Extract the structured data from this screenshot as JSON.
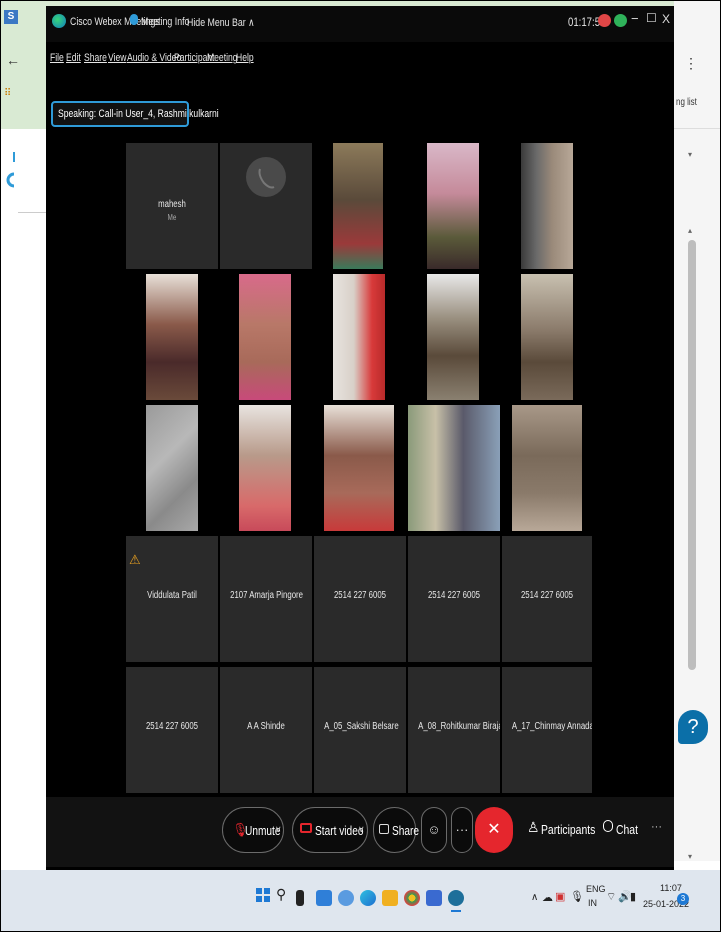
{
  "window": {
    "app_title": "Cisco Webex Meetings",
    "meeting_info": "Meeting Info",
    "hide_menu": "Hide Menu Bar ∧",
    "timer": "01:17:55",
    "minimize": "−",
    "maximize": "☐",
    "close": "X"
  },
  "menu": [
    "File",
    "Edit",
    "Share",
    "View",
    "Audio & Video",
    "Participant",
    "Meeting",
    "Help"
  ],
  "speaking": "Speaking: Call-in User_4, Rashmi kulkarni",
  "browser": {
    "close": "X",
    "kebab": "⋮",
    "fragment": "ng list"
  },
  "tiles": {
    "row1": [
      {
        "name": "mahesh",
        "sub": "Me"
      }
    ],
    "names": [
      "Viddulata Patil",
      "2107 Amarja Pingore",
      "2514 227 6005",
      "2514 227 6005",
      "2514 227 6005",
      "2514 227 6005",
      "A A Shinde",
      "A_05_Sakshi Belsare",
      "A_08_Rohitkumar Birajadar",
      "A_17_Chinmay Annadate"
    ],
    "warning_icon": "⚠"
  },
  "toolbar": {
    "unmute": "Unmute",
    "start_video": "Start video",
    "share": "Share",
    "participants": "Participants",
    "chat": "Chat",
    "more": "···",
    "chevron": "∨"
  },
  "taskbar": {
    "lang1": "ENG",
    "lang2": "IN",
    "time": "11:07",
    "date": "25-01-2022",
    "notif": "3",
    "caret": "∧"
  },
  "colors": {
    "accent": "#2f9bd8",
    "end_call": "#e5262d",
    "tile_bg": "#2a2a2a",
    "browser_bg": "#d9ead3"
  }
}
